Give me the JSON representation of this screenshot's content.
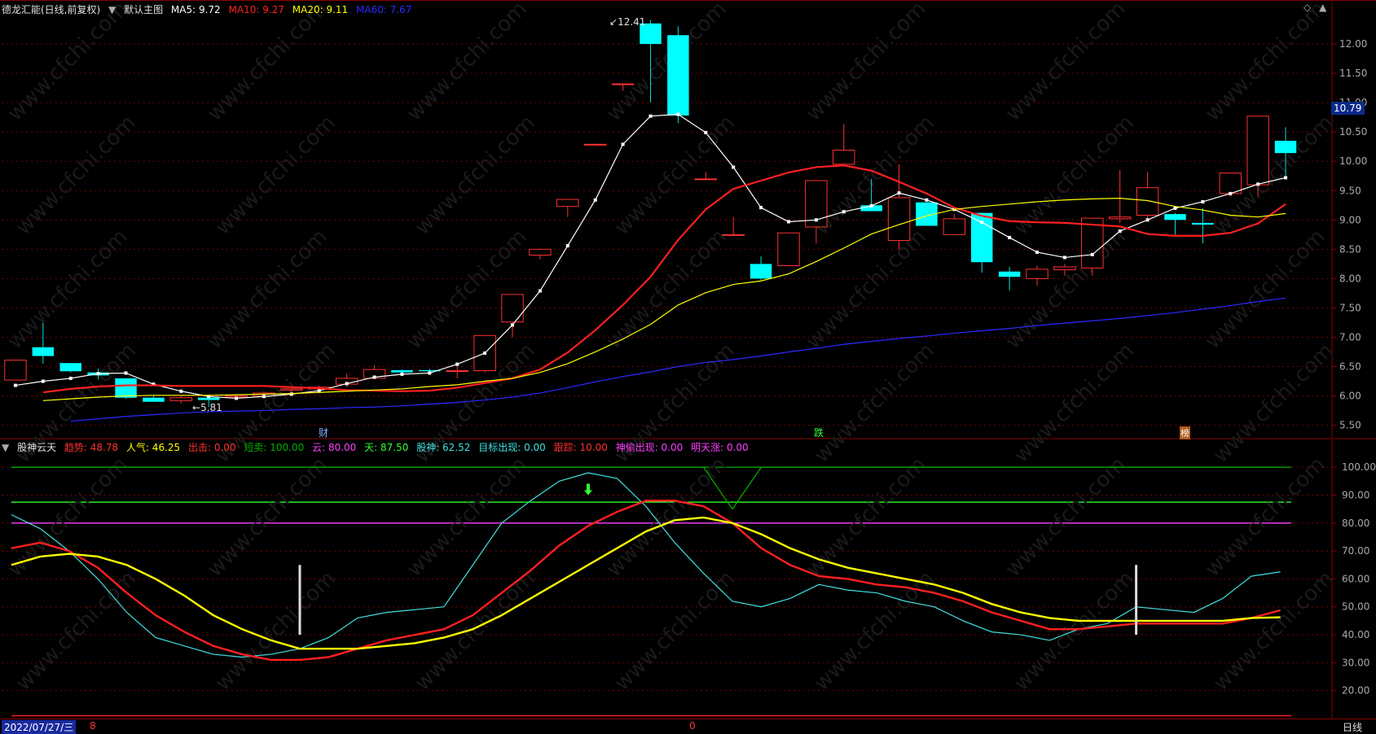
{
  "main_header": {
    "stock_name": "德龙汇能(日线,前复权)",
    "main_chart_label": "默认主图",
    "ma": [
      {
        "label": "MA5: 9.72",
        "color": "#ffffff"
      },
      {
        "label": "MA10: 9.27",
        "color": "#ff2020"
      },
      {
        "label": "MA20: 9.11",
        "color": "#ffff00"
      },
      {
        "label": "MA60: 7.67",
        "color": "#2a2aff"
      }
    ]
  },
  "sub_header": {
    "indicator_name": "股神云天",
    "items": [
      {
        "label": "趋势: 48.78",
        "color": "#ff3030"
      },
      {
        "label": "人气: 46.25",
        "color": "#ffff00"
      },
      {
        "label": "出击: 0.00",
        "color": "#ff3030"
      },
      {
        "label": "短卖: 100.00",
        "color": "#00b000"
      },
      {
        "label": "云: 80.00",
        "color": "#ff40ff"
      },
      {
        "label": "天: 87.50",
        "color": "#30ff30"
      },
      {
        "label": "股神: 62.52",
        "color": "#40e0e0"
      },
      {
        "label": "目标出现: 0.00",
        "color": "#40e0e0"
      },
      {
        "label": "跟踪: 10.00",
        "color": "#ff3030"
      },
      {
        "label": "神偷出现: 0.00",
        "color": "#ff40ff"
      },
      {
        "label": "明天涨: 0.00",
        "color": "#ff40ff"
      }
    ]
  },
  "current_price_tag": "10.79",
  "high_label": "12.41",
  "low_label": "5.81",
  "event_markers": [
    "财",
    "跌",
    "榜"
  ],
  "status_bar": {
    "date": "2022/07/27/三",
    "left_num": "8",
    "mid_num": "0",
    "period": "日线"
  },
  "chart_data": [
    {
      "type": "candlestick",
      "title": "德龙汇能(日线,前复权)",
      "ylim": [
        5.3,
        12.5
      ],
      "y_ticks": [
        5.5,
        6.0,
        6.5,
        7.0,
        7.5,
        8.0,
        8.5,
        9.0,
        9.5,
        10.0,
        10.5,
        11.0,
        11.5,
        12.0
      ],
      "candles": [
        {
          "o": 6.27,
          "c": 6.61,
          "h": 6.61,
          "l": 6.27
        },
        {
          "o": 6.83,
          "c": 6.68,
          "h": 7.25,
          "l": 6.55
        },
        {
          "o": 6.56,
          "c": 6.42,
          "h": 6.56,
          "l": 6.4
        },
        {
          "o": 6.4,
          "c": 6.35,
          "h": 6.47,
          "l": 6.28
        },
        {
          "o": 6.3,
          "c": 5.97,
          "h": 6.3,
          "l": 5.95
        },
        {
          "o": 5.97,
          "c": 5.9,
          "h": 6.0,
          "l": 5.9
        },
        {
          "o": 5.92,
          "c": 5.97,
          "h": 6.0,
          "l": 5.87
        },
        {
          "o": 5.97,
          "c": 5.93,
          "h": 6.0,
          "l": 5.81
        },
        {
          "o": 5.98,
          "c": 6.0,
          "h": 6.03,
          "l": 5.95
        },
        {
          "o": 6.0,
          "c": 6.05,
          "h": 6.08,
          "l": 5.97
        },
        {
          "o": 6.1,
          "c": 6.12,
          "h": 6.13,
          "l": 6.05
        },
        {
          "o": 6.12,
          "c": 6.15,
          "h": 6.18,
          "l": 6.08
        },
        {
          "o": 6.2,
          "c": 6.3,
          "h": 6.38,
          "l": 6.15
        },
        {
          "o": 6.3,
          "c": 6.45,
          "h": 6.52,
          "l": 6.28
        },
        {
          "o": 6.44,
          "c": 6.4,
          "h": 6.45,
          "l": 6.38
        },
        {
          "o": 6.44,
          "c": 6.42,
          "h": 6.46,
          "l": 6.38
        },
        {
          "o": 6.42,
          "c": 6.43,
          "h": 6.5,
          "l": 6.3
        },
        {
          "o": 6.43,
          "c": 7.03,
          "h": 7.03,
          "l": 6.4
        },
        {
          "o": 7.26,
          "c": 7.73,
          "h": 7.73,
          "l": 7.0
        },
        {
          "o": 8.4,
          "c": 8.5,
          "h": 8.5,
          "l": 8.33
        },
        {
          "o": 9.23,
          "c": 9.35,
          "h": 9.35,
          "l": 9.05
        },
        {
          "o": 10.29,
          "c": 10.29,
          "h": 10.29,
          "l": 10.29
        },
        {
          "o": 11.32,
          "c": 11.32,
          "h": 11.32,
          "l": 11.2
        },
        {
          "o": 12.35,
          "c": 12.0,
          "h": 12.41,
          "l": 11.0
        },
        {
          "o": 12.15,
          "c": 10.78,
          "h": 12.3,
          "l": 10.65
        },
        {
          "o": 9.7,
          "c": 9.7,
          "h": 9.82,
          "l": 9.7
        },
        {
          "o": 8.75,
          "c": 8.75,
          "h": 9.05,
          "l": 8.75
        },
        {
          "o": 8.25,
          "c": 8.0,
          "h": 8.38,
          "l": 7.98
        },
        {
          "o": 8.22,
          "c": 8.78,
          "h": 8.78,
          "l": 8.22
        },
        {
          "o": 8.88,
          "c": 9.67,
          "h": 9.67,
          "l": 8.6
        },
        {
          "o": 9.95,
          "c": 10.19,
          "h": 10.63,
          "l": 9.95
        },
        {
          "o": 9.25,
          "c": 9.15,
          "h": 9.7,
          "l": 9.15
        },
        {
          "o": 8.65,
          "c": 9.38,
          "h": 9.95,
          "l": 8.5
        },
        {
          "o": 9.3,
          "c": 8.9,
          "h": 9.3,
          "l": 8.9
        },
        {
          "o": 8.75,
          "c": 9.02,
          "h": 9.1,
          "l": 8.75
        },
        {
          "o": 9.12,
          "c": 8.28,
          "h": 9.12,
          "l": 8.1
        },
        {
          "o": 8.12,
          "c": 8.03,
          "h": 8.2,
          "l": 7.8
        },
        {
          "o": 8.0,
          "c": 8.16,
          "h": 8.22,
          "l": 7.88
        },
        {
          "o": 8.15,
          "c": 8.2,
          "h": 8.25,
          "l": 8.05
        },
        {
          "o": 8.18,
          "c": 9.03,
          "h": 9.03,
          "l": 8.05
        },
        {
          "o": 9.02,
          "c": 9.05,
          "h": 9.85,
          "l": 8.95
        },
        {
          "o": 9.08,
          "c": 9.55,
          "h": 9.82,
          "l": 9.0
        },
        {
          "o": 9.1,
          "c": 9.0,
          "h": 9.12,
          "l": 8.75
        },
        {
          "o": 8.95,
          "c": 8.92,
          "h": 9.2,
          "l": 8.6
        },
        {
          "o": 9.45,
          "c": 9.8,
          "h": 9.8,
          "l": 9.4
        },
        {
          "o": 9.6,
          "c": 10.77,
          "h": 10.77,
          "l": 9.4
        },
        {
          "o": 10.35,
          "c": 10.14,
          "h": 10.58,
          "l": 9.75
        }
      ],
      "series": [
        {
          "name": "MA5",
          "color": "#ffffff",
          "markers": true,
          "values": [
            6.18,
            6.25,
            6.3,
            6.38,
            6.39,
            6.2,
            6.08,
            5.99,
            5.96,
            5.99,
            6.03,
            6.09,
            6.21,
            6.32,
            6.37,
            6.39,
            6.54,
            6.73,
            7.21,
            7.79,
            8.56,
            9.34,
            10.29,
            10.77,
            10.8,
            10.49,
            9.9,
            9.21,
            8.97,
            9.0,
            9.14,
            9.24,
            9.46,
            9.34,
            9.18,
            8.96,
            8.7,
            8.45,
            8.36,
            8.41,
            8.81,
            9.0,
            9.2,
            9.31,
            9.45,
            9.61,
            9.72
          ]
        },
        {
          "name": "MA10",
          "color": "#ff2020",
          "values": [
            6.06,
            6.12,
            6.16,
            6.18,
            6.18,
            6.17,
            6.17,
            6.17,
            6.17,
            6.15,
            6.13,
            6.1,
            6.09,
            6.08,
            6.09,
            6.14,
            6.22,
            6.3,
            6.45,
            6.74,
            7.12,
            7.55,
            8.03,
            8.66,
            9.18,
            9.53,
            9.67,
            9.81,
            9.9,
            9.93,
            9.84,
            9.65,
            9.45,
            9.21,
            9.07,
            8.98,
            8.96,
            8.95,
            8.92,
            8.89,
            8.76,
            8.73,
            8.73,
            8.78,
            8.94,
            9.27
          ]
        },
        {
          "name": "MA20",
          "color": "#ffff00",
          "values": [
            5.92,
            5.95,
            5.98,
            6.0,
            6.01,
            6.01,
            6.01,
            6.02,
            6.03,
            6.04,
            6.06,
            6.08,
            6.1,
            6.12,
            6.16,
            6.19,
            6.25,
            6.3,
            6.4,
            6.55,
            6.75,
            6.97,
            7.22,
            7.55,
            7.76,
            7.9,
            7.96,
            8.08,
            8.29,
            8.52,
            8.76,
            8.92,
            9.07,
            9.18,
            9.23,
            9.27,
            9.31,
            9.34,
            9.36,
            9.37,
            9.33,
            9.23,
            9.17,
            9.08,
            9.05,
            9.11
          ]
        },
        {
          "name": "MA60",
          "color": "#2a2aff",
          "values": [
            5.57,
            5.61,
            5.65,
            5.68,
            5.71,
            5.73,
            5.74,
            5.75,
            5.77,
            5.78,
            5.8,
            5.81,
            5.83,
            5.86,
            5.89,
            5.93,
            5.98,
            6.05,
            6.14,
            6.24,
            6.33,
            6.41,
            6.5,
            6.57,
            6.62,
            6.68,
            6.75,
            6.81,
            6.88,
            6.93,
            6.98,
            7.02,
            7.07,
            7.11,
            7.15,
            7.2,
            7.24,
            7.28,
            7.32,
            7.37,
            7.42,
            7.48,
            7.54,
            7.61,
            7.67
          ]
        }
      ]
    },
    {
      "type": "line",
      "title": "股神云天",
      "ylim": [
        10,
        105
      ],
      "y_ticks": [
        20,
        30,
        40,
        50,
        60,
        70,
        80,
        90,
        100
      ],
      "hlines": [
        {
          "value": 100,
          "color": "#00b000"
        },
        {
          "value": 87.5,
          "color": "#30ff30"
        },
        {
          "value": 80,
          "color": "#ff40ff"
        },
        {
          "value": 11,
          "color": "#ff2020"
        },
        {
          "value": -0.5,
          "color": "#ff40ff"
        }
      ],
      "series": [
        {
          "name": "股神",
          "color": "#40e0e0",
          "values": [
            83,
            78,
            70,
            60,
            48,
            39,
            36,
            33,
            32,
            33,
            35,
            39,
            46,
            48,
            49,
            50,
            65,
            80,
            88,
            95,
            98,
            96,
            86,
            73,
            62,
            52,
            50,
            53,
            58,
            56,
            55,
            52,
            50,
            45,
            41,
            40,
            38,
            42,
            44,
            50,
            49,
            48,
            53,
            61,
            62.52
          ]
        },
        {
          "name": "趋势",
          "color": "#ff2020",
          "values": [
            71,
            73,
            70,
            64,
            55,
            47,
            41,
            36,
            33,
            31,
            31,
            32,
            35,
            38,
            40,
            42,
            47,
            55,
            63,
            72,
            79,
            84,
            88,
            88,
            86,
            80,
            71,
            65,
            61,
            60,
            58,
            57,
            55,
            52,
            48,
            45,
            42,
            42,
            43,
            44,
            44,
            44,
            44,
            46,
            48.78
          ]
        },
        {
          "name": "人气",
          "color": "#ffff00",
          "values": [
            65,
            68,
            69,
            68,
            65,
            60,
            54,
            47,
            42,
            38,
            35,
            35,
            35,
            36,
            37,
            39,
            42,
            47,
            53,
            59,
            65,
            71,
            77,
            81,
            82,
            80,
            76,
            71,
            67,
            64,
            62,
            60,
            58,
            55,
            51,
            48,
            46,
            45,
            45,
            45,
            45,
            45,
            45,
            46,
            46.25
          ]
        },
        {
          "name": "短卖",
          "color": "#00b000",
          "values": [
            100,
            100,
            100,
            100,
            100,
            100,
            100,
            100,
            100,
            100,
            100,
            100,
            100,
            100,
            100,
            100,
            100,
            100,
            100,
            100,
            100,
            100,
            100,
            100,
            100,
            85,
            100,
            100,
            100,
            100,
            100,
            100,
            100,
            100,
            100,
            100,
            100,
            100,
            100,
            100,
            100,
            100,
            100,
            100,
            100
          ]
        }
      ],
      "signals": [
        {
          "type": "bar",
          "index": 10,
          "from": 40,
          "to": 65,
          "color": "#dddddd"
        },
        {
          "type": "bar",
          "index": 39,
          "from": 40,
          "to": 65,
          "color": "#dddddd"
        },
        {
          "type": "arrow",
          "index": 20,
          "value": 90,
          "color": "#30ff30"
        }
      ]
    }
  ]
}
